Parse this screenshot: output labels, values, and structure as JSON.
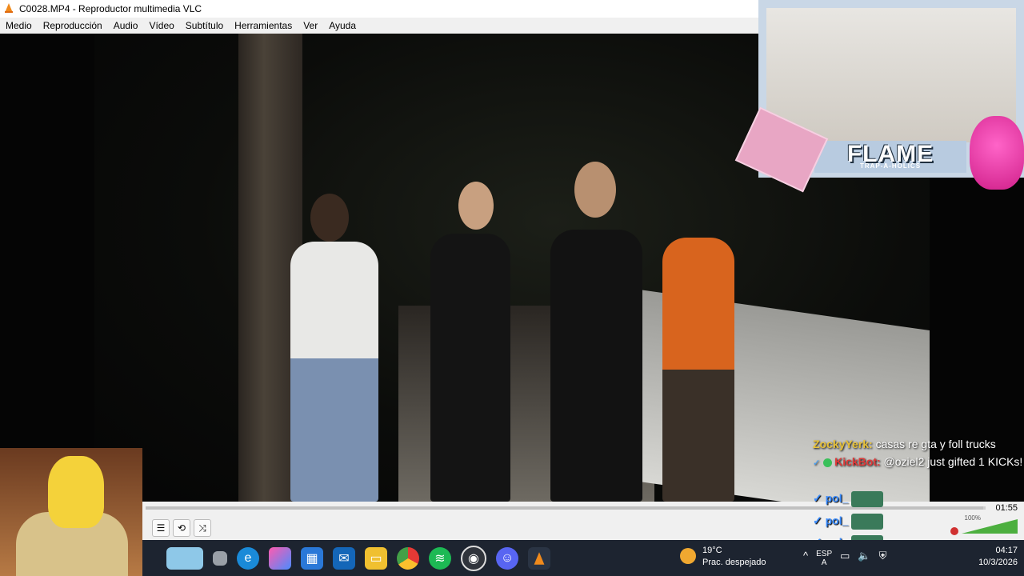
{
  "window": {
    "title": "C0028.MP4 - Reproductor multimedia VLC"
  },
  "menu": [
    "Medio",
    "Reproducción",
    "Audio",
    "Vídeo",
    "Subtítulo",
    "Herramientas",
    "Ver",
    "Ayuda"
  ],
  "overlay": {
    "banner_title": "FLAME",
    "banner_sub": "TRAP-A-HOLICS"
  },
  "chat": {
    "msg1_user": "ZockyYerk:",
    "msg1_text": " casas re gta y foll trucks",
    "msg2_user": "KickBot:",
    "msg2_text": " @oziel2 just gifted 1 KICKs!",
    "pol_user": "pol_"
  },
  "player": {
    "elapsed_time": "01:55",
    "volume": "100%",
    "progress": 0.997
  },
  "taskbar": {
    "temperature": "19°C",
    "weather_desc": "Prac. despejado",
    "lang": "ESP",
    "lang_sub": "A",
    "time": "04:17",
    "date": "10/3/2026"
  }
}
